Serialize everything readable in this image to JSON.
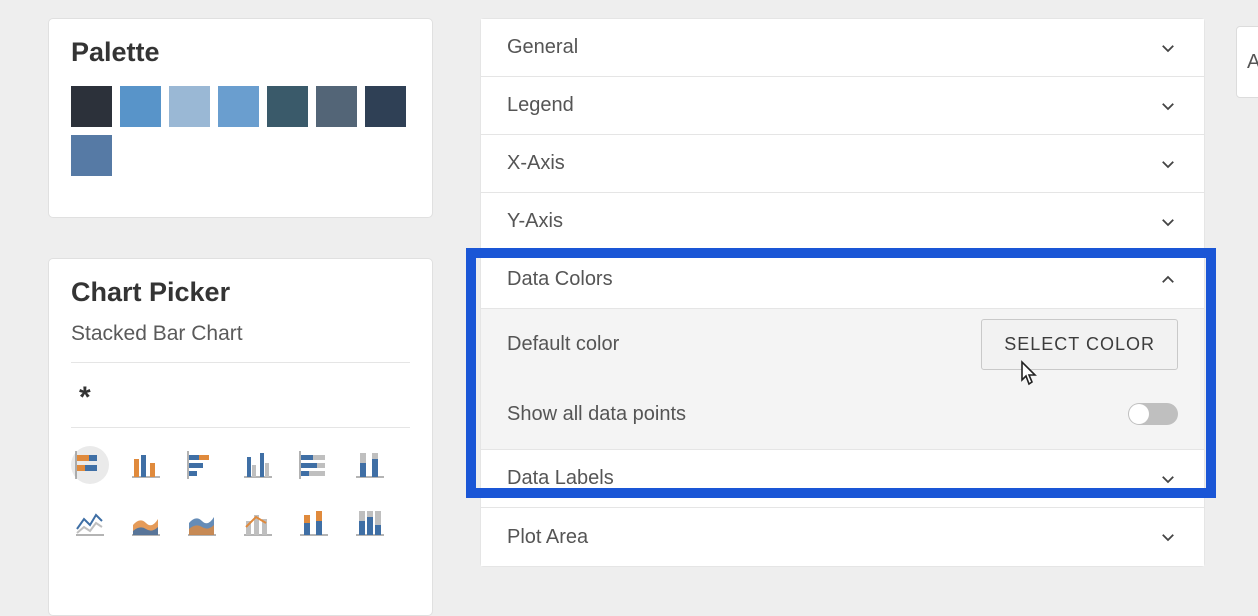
{
  "palette": {
    "title": "Palette",
    "swatches": [
      {
        "name": "slate-dark",
        "hex": "#2c313a"
      },
      {
        "name": "blue-500",
        "hex": "#5894c9"
      },
      {
        "name": "blue-300",
        "hex": "#9ab8d5"
      },
      {
        "name": "blue-400",
        "hex": "#6a9ecf"
      },
      {
        "name": "teal-700",
        "hex": "#3a5a6a"
      },
      {
        "name": "gray-blue",
        "hex": "#536577"
      },
      {
        "name": "navy-800",
        "hex": "#2f4055"
      },
      {
        "name": "steel-blue",
        "hex": "#567aa5"
      }
    ]
  },
  "chart_picker": {
    "title": "Chart Picker",
    "subtype": "Stacked Bar Chart",
    "required_marker": "*",
    "thumbs": [
      {
        "name": "stacked-bar-h",
        "selected": true
      },
      {
        "name": "clustered-column",
        "selected": false
      },
      {
        "name": "stacked-bar-h-alt",
        "selected": false
      },
      {
        "name": "clustered-column-alt",
        "selected": false
      },
      {
        "name": "stacked-bar-h-100",
        "selected": false
      },
      {
        "name": "clustered-column-100",
        "selected": false
      },
      {
        "name": "line",
        "selected": false
      },
      {
        "name": "area-stacked",
        "selected": false
      },
      {
        "name": "area-stacked-alt",
        "selected": false
      },
      {
        "name": "column-line-combo",
        "selected": false
      },
      {
        "name": "stacked-column",
        "selected": false
      },
      {
        "name": "stacked-column-100",
        "selected": false
      }
    ]
  },
  "accordion": {
    "items": [
      {
        "label": "General",
        "expanded": false
      },
      {
        "label": "Legend",
        "expanded": false
      },
      {
        "label": "X-Axis",
        "expanded": false
      },
      {
        "label": "Y-Axis",
        "expanded": false
      },
      {
        "label": "Data Colors",
        "expanded": true
      },
      {
        "label": "Data Labels",
        "expanded": false
      },
      {
        "label": "Plot Area",
        "expanded": false
      }
    ],
    "data_colors": {
      "default_color_label": "Default color",
      "select_color_button": "SELECT COLOR",
      "show_all_label": "Show all data points",
      "show_all_value": false
    }
  },
  "edge_panel": {
    "text": "A"
  }
}
